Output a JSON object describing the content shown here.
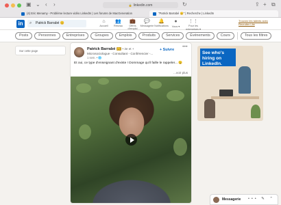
{
  "browser": {
    "url": "linkedin.com",
    "tabs": [
      {
        "label": "(4) Eric Menamy - Problème lecture vidéo LinkedIn | Les forums de MacGeneration",
        "active": false
      },
      {
        "label": "\"Patrick Barrabé 😊\" | Recherche | LinkedIn",
        "active": true
      }
    ]
  },
  "header": {
    "logo": "in",
    "search_value": "Patrick Barrabé 😊",
    "nav": [
      {
        "label": "Accueil",
        "icon": "home-icon",
        "glyph": "⌂"
      },
      {
        "label": "Réseau",
        "icon": "network-icon",
        "glyph": "👥"
      },
      {
        "label": "Offres d'emploi",
        "icon": "jobs-icon",
        "glyph": "💼"
      },
      {
        "label": "Messagerie",
        "icon": "messaging-icon",
        "glyph": "💬"
      },
      {
        "label": "Notifications",
        "icon": "bell-icon",
        "glyph": "🔔"
      },
      {
        "label": "Vous ▾",
        "icon": "me-avatar",
        "glyph": "●"
      },
      {
        "label": "Pour les entreprises ▾",
        "icon": "grid-icon",
        "glyph": "⋮⋮"
      }
    ],
    "premium_link": "Trouvez les talents avec Recruiter Lite"
  },
  "filters": [
    "Posts",
    "Personnes",
    "Entreprises",
    "Groupes",
    "Emplois",
    "Produits",
    "Services",
    "Événements",
    "Cours",
    "Tous les filtres"
  ],
  "left_panel": {
    "label": "Sur cette page"
  },
  "post": {
    "author": "Patrick Barrabé",
    "badge": "😊",
    "degree": "• 3e et +",
    "follow_label": "+ Suivre",
    "headline": "Microsociologue - Consultant - Conférencier -...",
    "time": "1 sem. • 🌐",
    "text": "Et oui, ce type d'enseignant d'existe ! Dommage qu'il faille le rappeler... 😉",
    "see_more": "...voir plus",
    "menu": "•••"
  },
  "ad": {
    "headline": "See who's hiring on LinkedIn."
  },
  "messaging": {
    "title": "Messagerie",
    "icons": "••• ✎ ⌃"
  }
}
